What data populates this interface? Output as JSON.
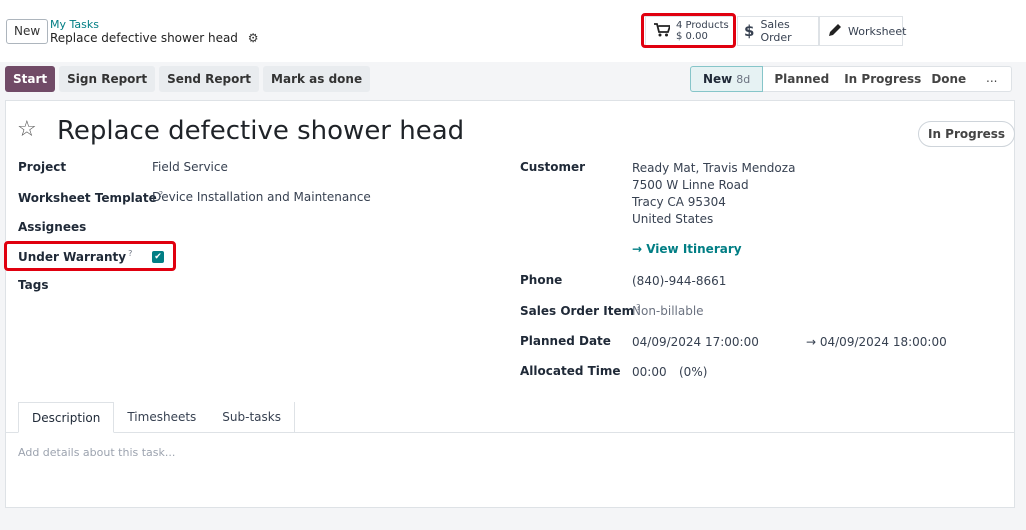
{
  "control_panel": {
    "new_label": "New",
    "breadcrumb_parent": "My Tasks",
    "breadcrumb_current": "Replace defective shower head"
  },
  "smart_buttons": {
    "products_count": "4 Products",
    "products_amount": "$ 0.00",
    "sales_order": "Sales Order",
    "worksheet": "Worksheet"
  },
  "actions": [
    "Start",
    "Sign Report",
    "Send Report",
    "Mark as done"
  ],
  "stages": {
    "current": "New",
    "current_days": "8d",
    "planned": "Planned",
    "in_progress": "In Progress",
    "done": "Done",
    "more": "..."
  },
  "task": {
    "title": "Replace defective shower head",
    "state": "In Progress"
  },
  "fields": {
    "project_label": "Project",
    "project_value": "Field Service",
    "worksheet_template_label": "Worksheet Template",
    "worksheet_template_value": "Device Installation and Maintenance",
    "assignees_label": "Assignees",
    "under_warranty_label": "Under Warranty",
    "tags_label": "Tags",
    "help_mark": "?",
    "customer_label": "Customer",
    "customer_name": "Ready Mat, Travis Mendoza",
    "customer_street": "7500 W Linne Road",
    "customer_city": "Tracy CA 95304",
    "customer_country": "United States",
    "view_itinerary": "→ View Itinerary",
    "phone_label": "Phone",
    "phone_value": "(840)-944-8661",
    "sales_order_item_label": "Sales Order Item",
    "sales_order_item_value": "Non-billable",
    "planned_date_label": "Planned Date",
    "planned_date_start": "04/09/2024 17:00:00",
    "planned_date_end": "→ 04/09/2024 18:00:00",
    "allocated_time_label": "Allocated Time",
    "allocated_time_value": "00:00",
    "allocated_time_percent": "(0%)"
  },
  "tabs": [
    "Description",
    "Timesheets",
    "Sub-tasks"
  ],
  "description_placeholder": "Add details about this task...",
  "colors": {
    "primary": "#714b67",
    "teal": "#017e84",
    "highlight": "#e0000f"
  }
}
